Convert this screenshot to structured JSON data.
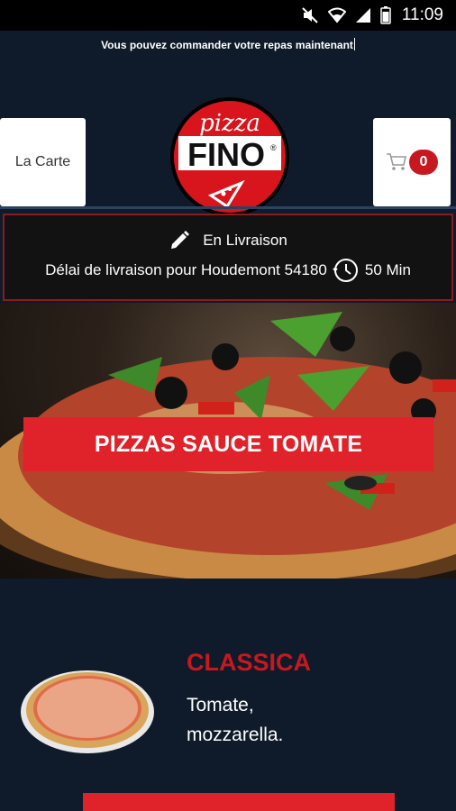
{
  "status_bar": {
    "time": "11:09",
    "icons": [
      "mute-icon",
      "wifi-icon",
      "signal-icon",
      "battery-icon"
    ]
  },
  "header": {
    "announcement": "Vous pouvez commander votre repas maintenant",
    "logo": {
      "top_text": "pizza",
      "bottom_text": "FINO",
      "trademark": "®"
    },
    "menu_button": "La Carte",
    "cart": {
      "icon": "cart-icon",
      "count": "0"
    }
  },
  "delivery": {
    "mode_icon": "pencil-icon",
    "mode": "En Livraison",
    "delay_label": "Délai de livraison pour Houdemont 54180",
    "clock_icon": "clock-icon",
    "delay_value": "50 Min"
  },
  "hero": {
    "banner": "PIZZAS SAUCE TOMATE"
  },
  "product": {
    "name": "CLASSICA",
    "description": "Tomate, mozzarella."
  },
  "colors": {
    "background": "#0f1a2a",
    "accent_red": "#e0222a",
    "title_red": "#c8181f",
    "delivery_bg": "#121212",
    "delivery_border": "#8a1c1c"
  }
}
